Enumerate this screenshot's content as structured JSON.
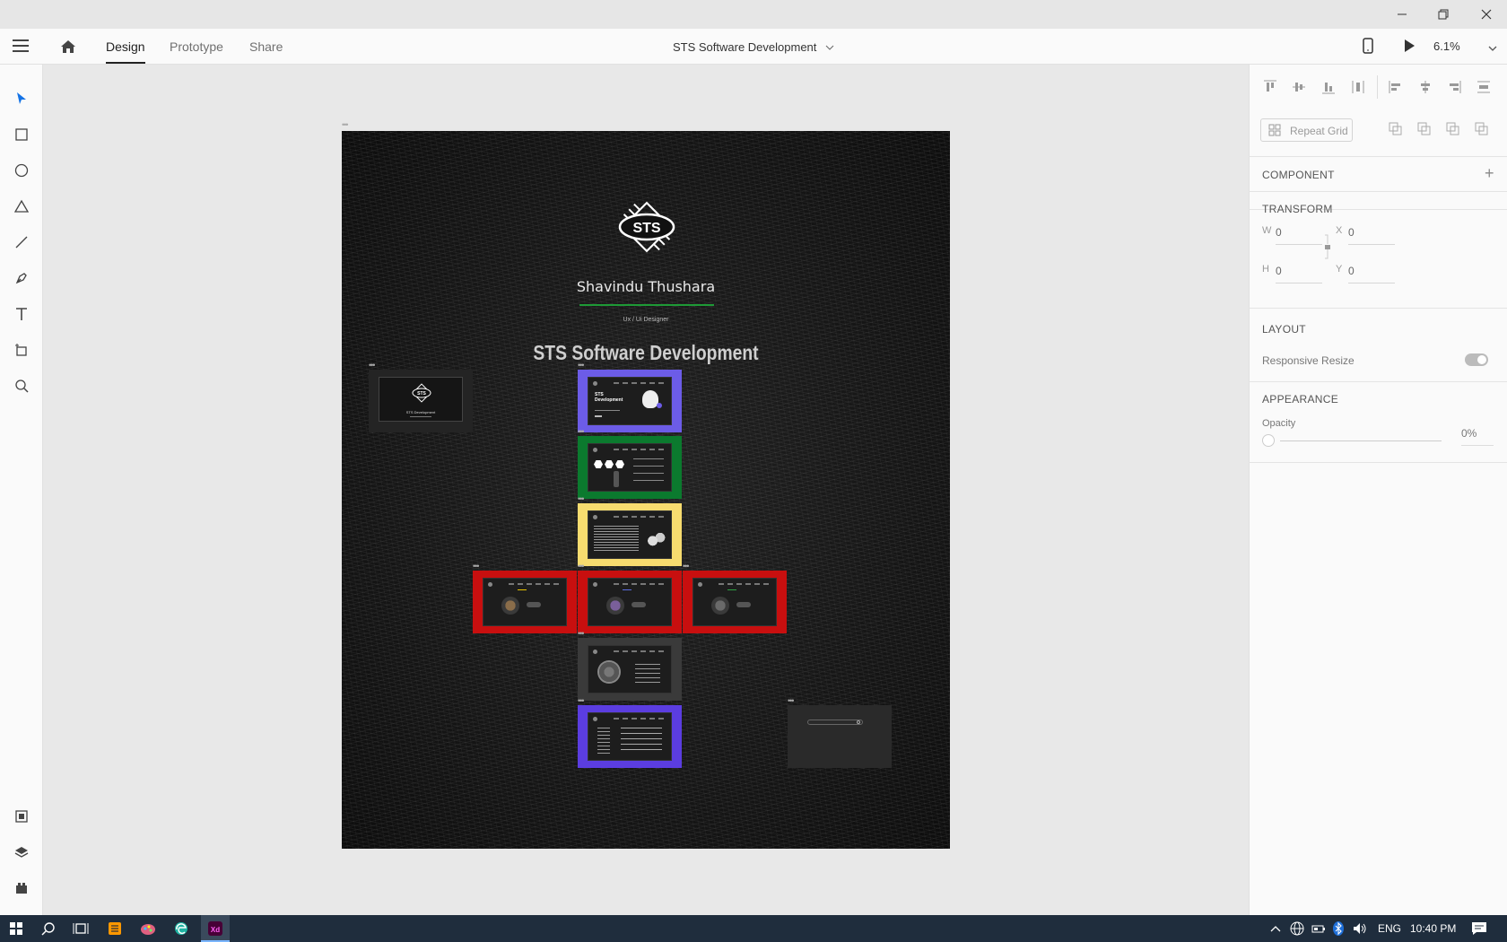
{
  "app": {
    "tabs": [
      "Design",
      "Prototype",
      "Share"
    ],
    "active_tab": "Design",
    "document_title": "STS Software Development",
    "zoom": "6.1%"
  },
  "left_tools": [
    "select-icon",
    "rectangle-icon",
    "ellipse-icon",
    "polygon-icon",
    "line-icon",
    "pen-icon",
    "text-icon",
    "artboard-icon",
    "zoom-icon",
    "assets-icon",
    "layers-icon",
    "plugins-icon"
  ],
  "artboard": {
    "logo_text": "STS",
    "author": "Shavindu Thushara",
    "role": "Ux  /  Ui  Designer",
    "title": "STS Software Development",
    "thumb_logo_text": "STS",
    "thumb_caption": "STS Development",
    "frame1_title": "STS Development"
  },
  "frames": [
    {
      "color": "#6c5ce7"
    },
    {
      "color": "#0b7a2e"
    },
    {
      "color": "#f7dc6f"
    },
    {
      "color": "#c80f0f"
    },
    {
      "color": "#c80f0f"
    },
    {
      "color": "#c80f0f"
    },
    {
      "color": "#3a3a3a"
    },
    {
      "color": "#5b3de0"
    },
    {
      "color": "#2a2a2a"
    }
  ],
  "right_panel": {
    "repeat_grid": "Repeat Grid",
    "component": "COMPONENT",
    "transform": "TRANSFORM",
    "w_label": "W",
    "w_value": "0",
    "x_label": "X",
    "x_value": "0",
    "h_label": "H",
    "h_value": "0",
    "y_label": "Y",
    "y_value": "0",
    "layout": "LAYOUT",
    "responsive_resize": "Responsive Resize",
    "appearance": "APPEARANCE",
    "opacity_label": "Opacity",
    "opacity_value": "0%"
  },
  "taskbar": {
    "language": "ENG",
    "time": "10:40 PM"
  }
}
